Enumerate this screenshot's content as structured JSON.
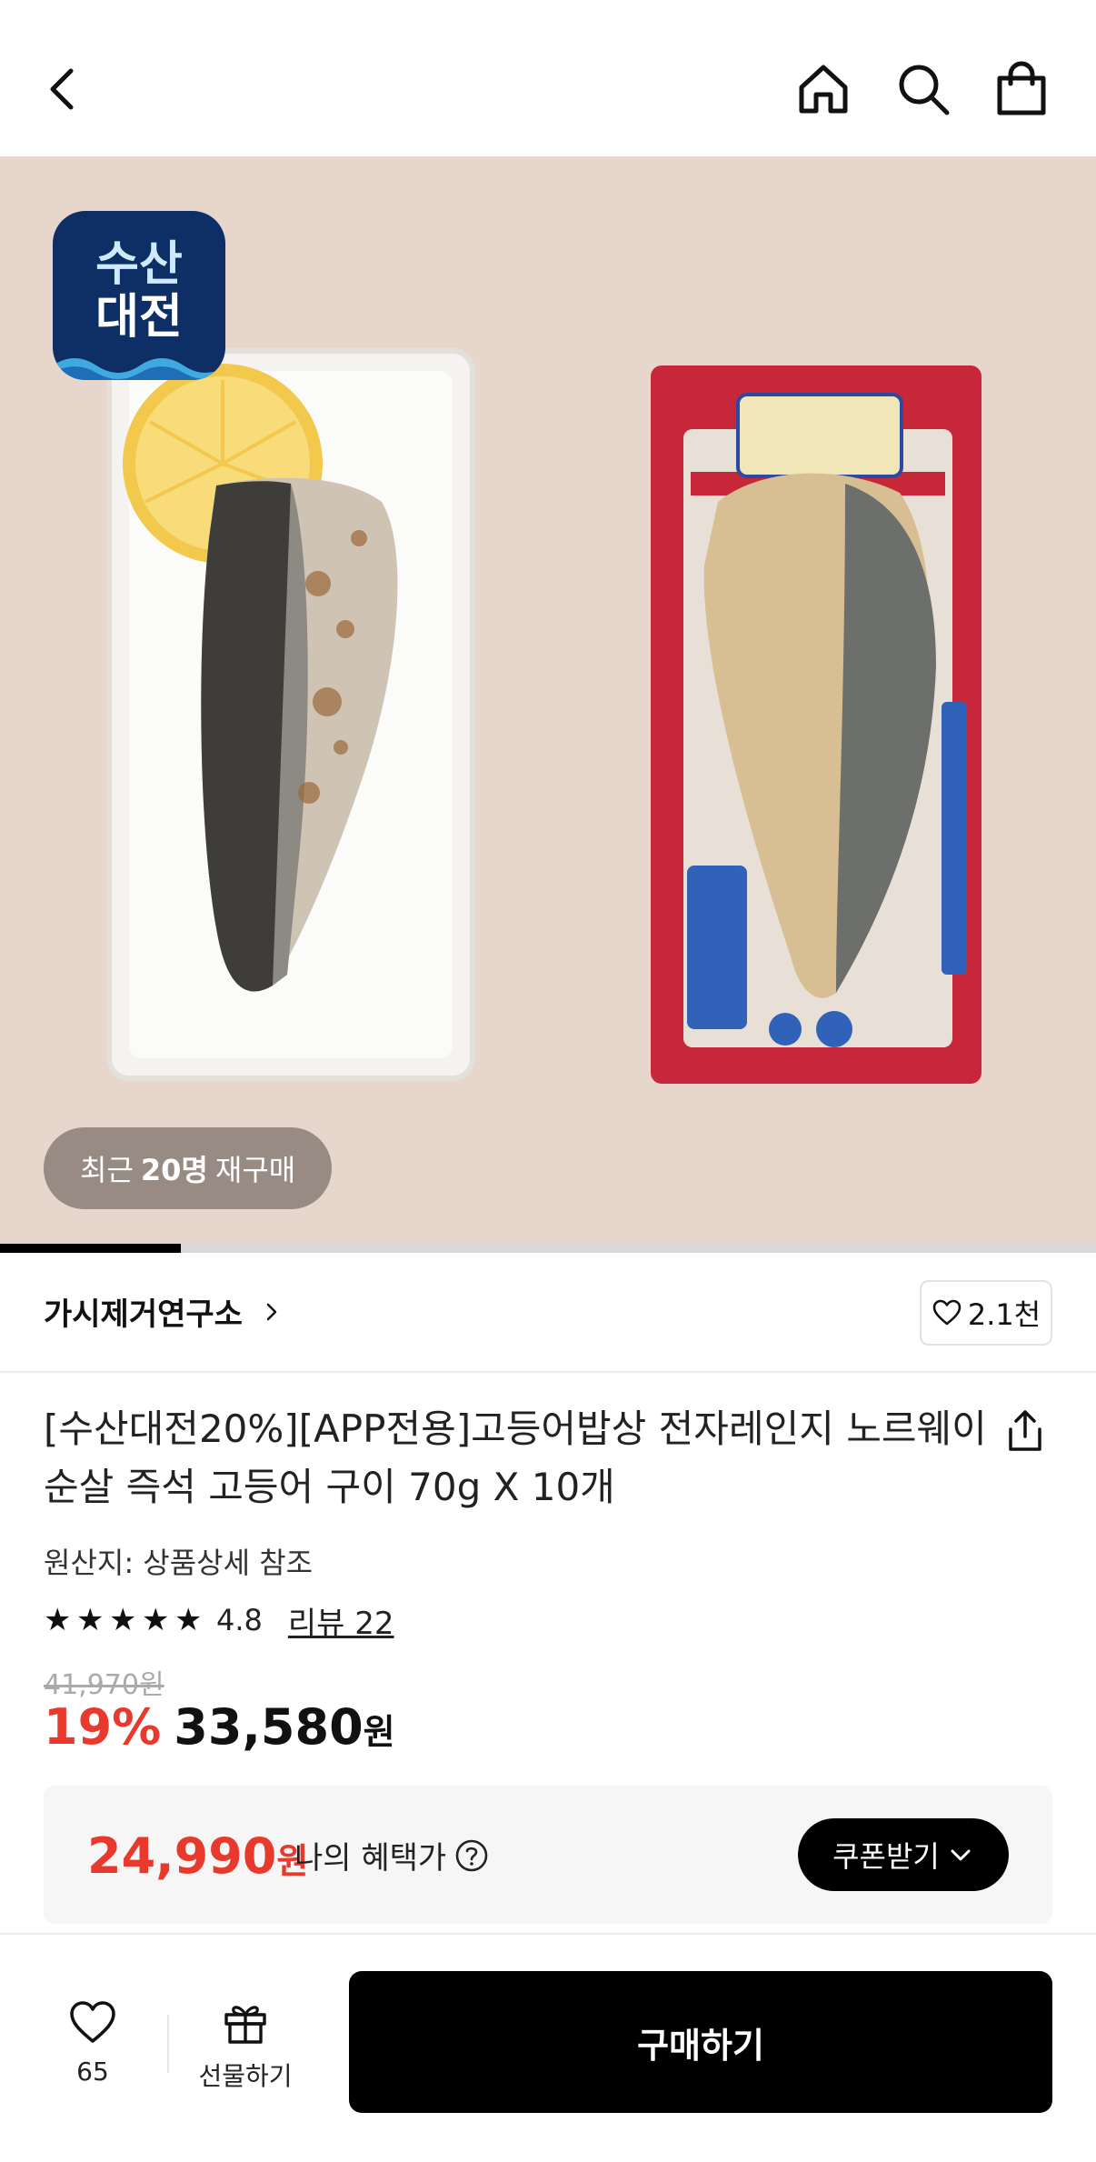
{
  "header": {
    "icons": [
      "back-icon",
      "home-icon",
      "search-icon",
      "shopping-bag-icon"
    ]
  },
  "hero": {
    "badge": {
      "line1": "수산",
      "line2": "대전"
    },
    "rebuy": {
      "prefix": "최근",
      "count": "20명",
      "suffix": "재구매"
    },
    "carousel_progress": 0.165
  },
  "brand": {
    "name": "가시제거연구소",
    "likes": "2.1천"
  },
  "product": {
    "title": "[수산대전20%][APP전용]고등어밥상 전자레인지 노르웨이 순살 즉석 고등어 구이 70g X 10개",
    "origin": "원산지: 상품상세 참조",
    "rating": "4.8",
    "rating_stars": 5,
    "reviews": "리뷰 22",
    "original_price": "41,970원",
    "discount": "19%",
    "price": "33,580",
    "price_unit": "원"
  },
  "benefit": {
    "price": "24,990",
    "price_unit": "원",
    "label": "나의 혜택가",
    "coupon_label": "쿠폰받기"
  },
  "bottom": {
    "wish_count": "65",
    "gift_label": "선물하기",
    "buy_label": "구매하기"
  },
  "colors": {
    "accent_red": "#e8392d",
    "primary_black": "#000000",
    "hero_bg": "#e6d6cb",
    "badge_navy": "#0d2f66"
  }
}
